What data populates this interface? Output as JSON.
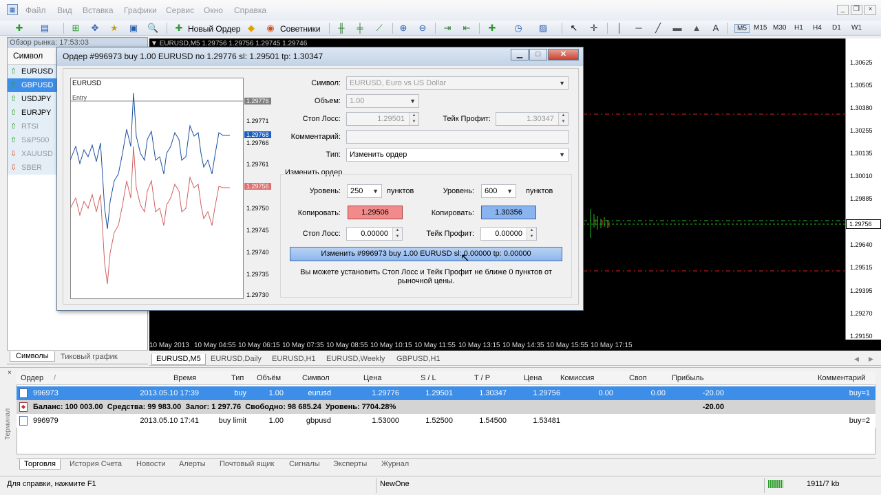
{
  "menu": {
    "items": [
      "Файл",
      "Вид",
      "Вставка",
      "Графики",
      "Сервис",
      "Окно",
      "Справка"
    ]
  },
  "toolbar": {
    "new_order": "Новый Ордер",
    "advisors": "Советники",
    "timeframes": [
      "M5",
      "M15",
      "M30",
      "H1",
      "H4",
      "D1",
      "W1"
    ]
  },
  "market_watch": {
    "title": "Обзор рынка: 17:53:03",
    "column": "Символ",
    "symbols": [
      {
        "name": "EURUSD",
        "dir": "up",
        "dim": false
      },
      {
        "name": "GBPUSD",
        "dir": "up",
        "dim": false
      },
      {
        "name": "USDJPY",
        "dir": "up",
        "dim": false
      },
      {
        "name": "EURJPY",
        "dir": "up",
        "dim": false
      },
      {
        "name": "RTSI",
        "dir": "up",
        "dim": true
      },
      {
        "name": "S&P500",
        "dir": "up",
        "dim": true
      },
      {
        "name": "XAUUSD",
        "dir": "down",
        "dim": true
      },
      {
        "name": "SBER",
        "dir": "down",
        "dim": true
      }
    ],
    "tabs": [
      "Символы",
      "Тиковый график"
    ]
  },
  "chart": {
    "title": "EURUSD,M5 1.29756 1.29756 1.29745 1.29746",
    "y_ticks": [
      "1.30625",
      "1.30505",
      "1.30380",
      "1.30255",
      "1.30135",
      "1.30010",
      "1.29885",
      "1.29640",
      "1.29515",
      "1.29395",
      "1.29270",
      "1.29150"
    ],
    "price_tag": "1.29756",
    "x_ticks": [
      "10 May 2013",
      "10 May 04:55",
      "10 May 06:15",
      "10 May 07:35",
      "10 May 08:55",
      "10 May 10:15",
      "10 May 11:55",
      "10 May 13:15",
      "10 May 14:35",
      "10 May 15:55",
      "10 May 17:15"
    ],
    "tabs": [
      "EURUSD,M5",
      "EURUSD,Daily",
      "EURUSD,H1",
      "EURUSD,Weekly",
      "GBPUSD,H1"
    ]
  },
  "dialog": {
    "title": "Ордер #996973 buy 1.00 EURUSD по 1.29776 sl: 1.29501 tp: 1.30347",
    "mini_chart": {
      "symbol": "EURUSD",
      "entry_label": "Entry",
      "y_ticks": [
        "1.29776",
        "1.29771",
        "1.29768",
        "1.29766",
        "1.29761",
        "1.29756",
        "1.29750",
        "1.29745",
        "1.29740",
        "1.29735",
        "1.29730"
      ]
    },
    "symbol_label": "Символ:",
    "symbol_value": "EURUSD, Euro vs US Dollar",
    "volume_label": "Объем:",
    "volume_value": "1.00",
    "sl_label": "Стоп Лосс:",
    "sl_value": "1.29501",
    "tp_label": "Тейк Профит:",
    "tp_value": "1.30347",
    "comment_label": "Комментарий:",
    "comment_value": "",
    "type_label": "Тип:",
    "type_value": "Изменить ордер",
    "section": "Изменить ордер",
    "level_label": "Уровень:",
    "level_sl": "250",
    "level_tp": "600",
    "points": "пунктов",
    "copy_label": "Копировать:",
    "copy_sl": "1.29506",
    "copy_tp": "1.30356",
    "new_sl_label": "Стоп Лосс:",
    "new_sl": "0.00000",
    "new_tp_label": "Тейк Профит:",
    "new_tp": "0.00000",
    "modify_button": "Изменить #996973 buy 1.00 EURUSD sl: 0.00000 tp: 0.00000",
    "note": "Вы можете установить Стоп Лосс и Тейк Профит не ближе 0 пунктов от рыночной цены."
  },
  "terminal": {
    "columns": [
      "Ордер",
      "/",
      "Время",
      "Тип",
      "Объём",
      "Символ",
      "Цена",
      "S / L",
      "T / P",
      "Цена",
      "Комиссия",
      "Своп",
      "Прибыль",
      "Комментарий"
    ],
    "rows": [
      {
        "order": "996973",
        "time": "2013.05.10 17:39",
        "type": "buy",
        "volume": "1.00",
        "symbol": "eurusd",
        "price": "1.29776",
        "sl": "1.29501",
        "tp": "1.30347",
        "cur": "1.29756",
        "commission": "0.00",
        "swap": "0.00",
        "profit": "-20.00",
        "comment": "buy=1"
      },
      {
        "order": "996979",
        "time": "2013.05.10 17:41",
        "type": "buy limit",
        "volume": "1.00",
        "symbol": "gbpusd",
        "price": "1.53000",
        "sl": "1.52500",
        "tp": "1.54500",
        "cur": "1.53481",
        "commission": "",
        "swap": "",
        "profit": "",
        "comment": "buy=2"
      }
    ],
    "balance_line": "Баланс: 100 003.00  Средства: 99 983.00  Залог: 1 297.76  Свободно: 98 685.24  Уровень: 7704.28%",
    "balance_profit": "-20.00",
    "tabs": [
      "Торговля",
      "История Счета",
      "Новости",
      "Алерты",
      "Почтовый ящик",
      "Сигналы",
      "Эксперты",
      "Журнал"
    ],
    "side_label": "Терминал"
  },
  "status": {
    "help": "Для справки, нажмите F1",
    "profile": "NewOne",
    "traffic": "1911/7 kb"
  }
}
